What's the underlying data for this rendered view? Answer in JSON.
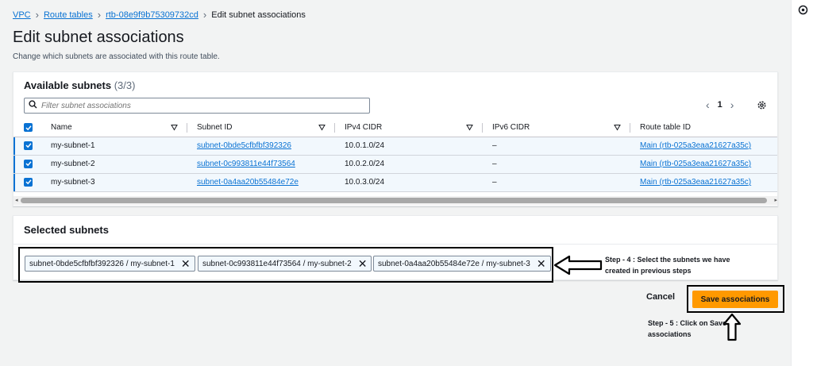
{
  "breadcrumb": {
    "items": [
      "VPC",
      "Route tables",
      "rtb-08e9f9b75309732cd"
    ],
    "current": "Edit subnet associations"
  },
  "page": {
    "title": "Edit subnet associations",
    "description": "Change which subnets are associated with this route table."
  },
  "available": {
    "title": "Available subnets",
    "count": "(3/3)",
    "filter_placeholder": "Filter subnet associations",
    "page_number": "1",
    "columns": [
      "Name",
      "Subnet ID",
      "IPv4 CIDR",
      "IPv6 CIDR",
      "Route table ID"
    ],
    "rows": [
      {
        "name": "my-subnet-1",
        "subnet_id": "subnet-0bde5cfbfbf392326",
        "ipv4": "10.0.1.0/24",
        "ipv6": "–",
        "route_table": "Main (rtb-025a3eaa21627a35c)"
      },
      {
        "name": "my-subnet-2",
        "subnet_id": "subnet-0c993811e44f73564",
        "ipv4": "10.0.2.0/24",
        "ipv6": "–",
        "route_table": "Main (rtb-025a3eaa21627a35c)"
      },
      {
        "name": "my-subnet-3",
        "subnet_id": "subnet-0a4aa20b55484e72e",
        "ipv4": "10.0.3.0/24",
        "ipv6": "–",
        "route_table": "Main (rtb-025a3eaa21627a35c)"
      }
    ]
  },
  "selected": {
    "title": "Selected subnets",
    "tokens": [
      "subnet-0bde5cfbfbf392326 / my-subnet-1",
      "subnet-0c993811e44f73564 / my-subnet-2",
      "subnet-0a4aa20b55484e72e / my-subnet-3"
    ]
  },
  "annotations": {
    "step4_line1": "Step - 4 : Select the subnets we have",
    "step4_line2": "created in previous steps",
    "step5_line1": "Step - 5 : Click on Save",
    "step5_line2": "associations"
  },
  "actions": {
    "cancel": "Cancel",
    "save": "Save associations"
  },
  "colors": {
    "accent": "#0972d3",
    "primary_button": "#ff9900"
  }
}
